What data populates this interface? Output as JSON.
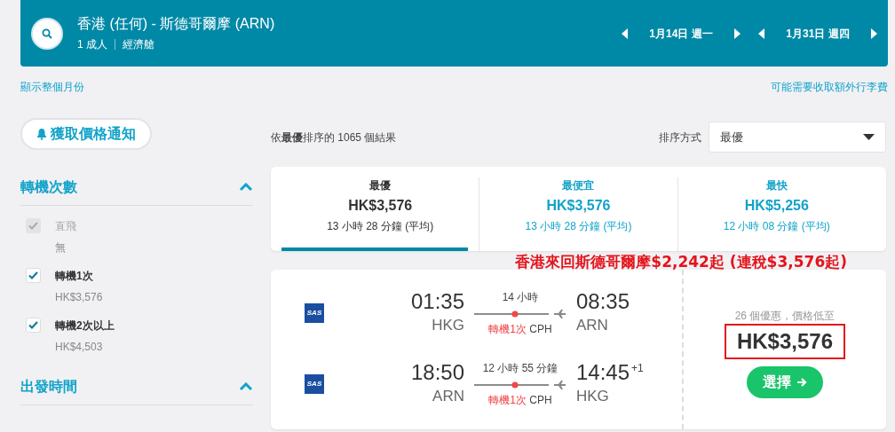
{
  "search": {
    "title": "香港 (任何) - 斯德哥爾摩 (ARN)",
    "passengers": "1 成人",
    "cabin": "經濟艙",
    "dates": [
      {
        "label": "1月14日 週一"
      },
      {
        "label": "1月31日 週四"
      }
    ]
  },
  "links": {
    "left": "顯示整個月份",
    "right": "可能需要收取額外行李費"
  },
  "alert_button": "獲取價格通知",
  "filters": [
    {
      "title": "轉機次數",
      "expanded": true,
      "options": [
        {
          "label": "直飛",
          "sub": "無",
          "checked": true,
          "disabled": true
        },
        {
          "label": "轉機1次",
          "sub": "HK$3,576",
          "checked": true,
          "disabled": false
        },
        {
          "label": "轉機2次以上",
          "sub": "HK$4,503",
          "checked": true,
          "disabled": false
        }
      ]
    },
    {
      "title": "出發時間",
      "expanded": true
    }
  ],
  "results_summary": "依**最優**排序的 1065 個結果",
  "sort": {
    "label": "排序方式",
    "value": "最優"
  },
  "sort_tabs": [
    {
      "label": "最優",
      "price": "HK$3,576",
      "duration": "13 小時 28 分鐘 (平均)",
      "selected": true
    },
    {
      "label": "最便宜",
      "price": "HK$3,576",
      "duration": "13 小時 28 分鐘 (平均)",
      "selected": false
    },
    {
      "label": "最快",
      "price": "HK$5,256",
      "duration": "12 小時 08 分鐘 (平均)",
      "selected": false
    }
  ],
  "annotation": "香港來回斯德哥爾摩$2,242起 (連稅$3,576起)",
  "flights": [
    {
      "legs": [
        {
          "logo": "SAS",
          "depart_time": "01:35",
          "depart_airport": "HKG",
          "duration": "14 小時",
          "stops": "轉機1次",
          "via": "CPH",
          "arrive_time": "08:35",
          "arrive_airport": "ARN"
        },
        {
          "logo": "SAS",
          "depart_time": "18:50",
          "depart_airport": "ARN",
          "duration": "12 小時 55 分鐘",
          "stops": "轉機1次",
          "via": "CPH",
          "arrive_time": "14:45",
          "day_offset": "+1",
          "arrive_airport": "HKG"
        }
      ],
      "deals": "26 個優惠，價格低至",
      "price": "HK$3,576",
      "highlighted": true,
      "button": "選擇"
    }
  ]
}
